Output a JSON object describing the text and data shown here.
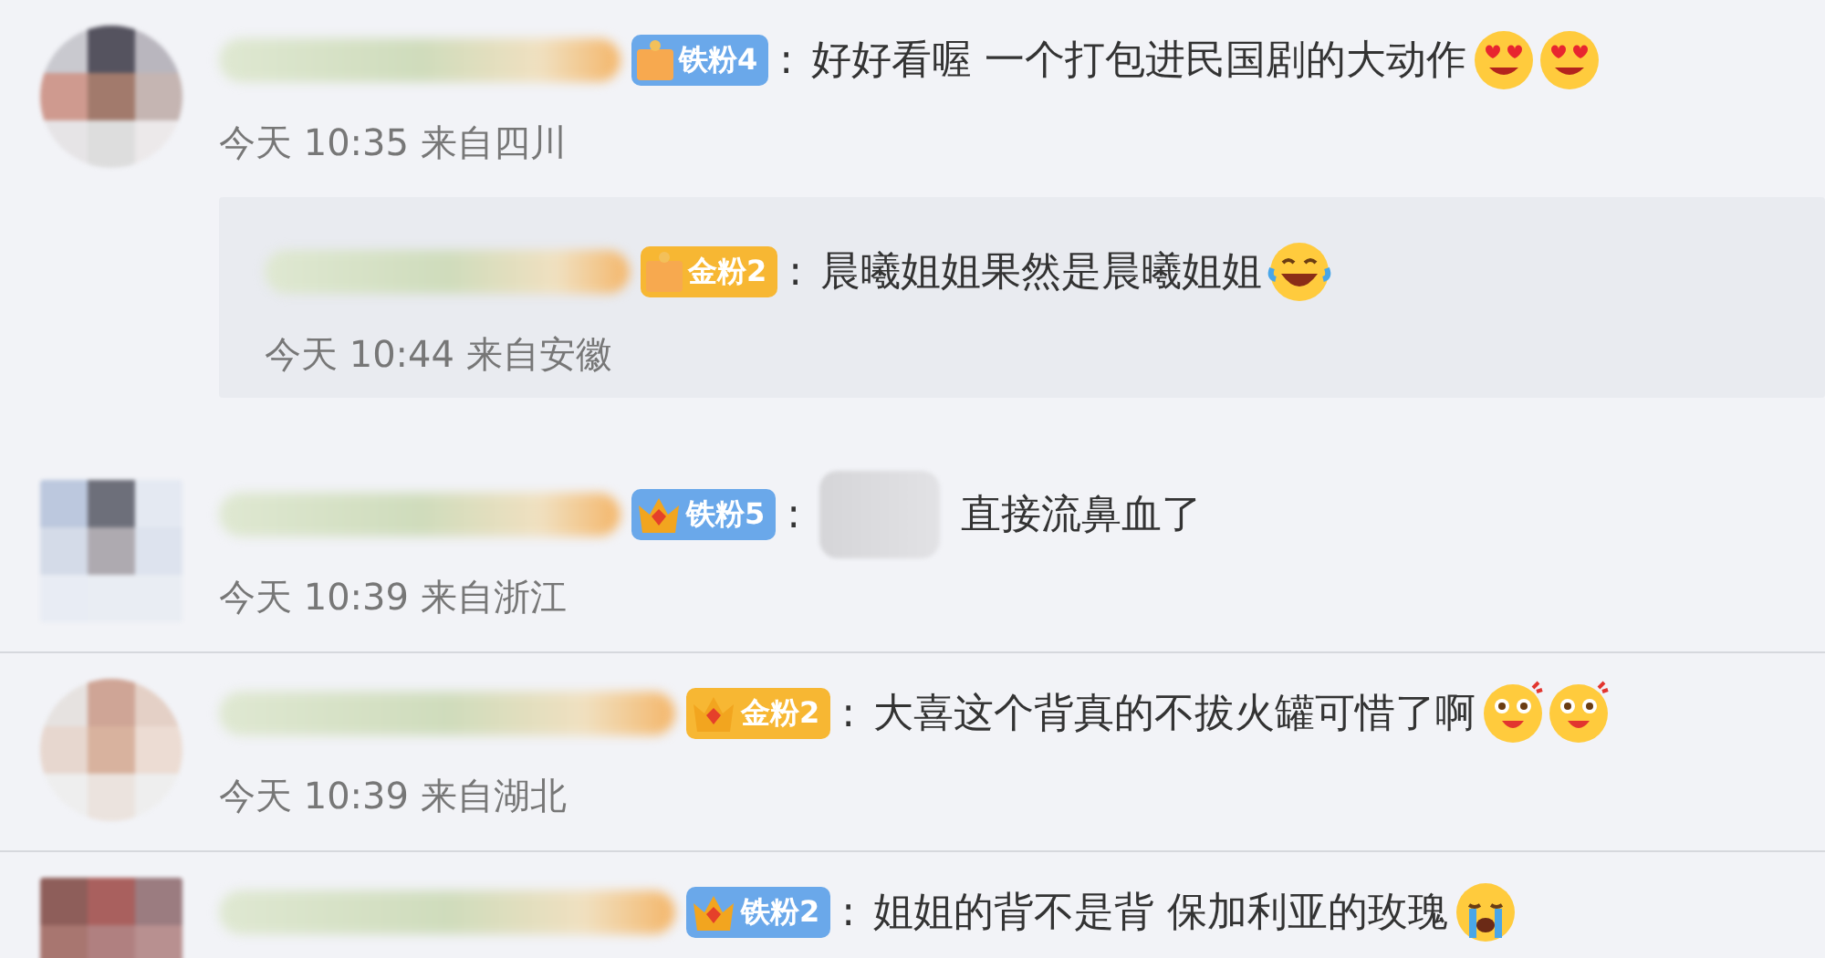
{
  "comments": [
    {
      "badge": {
        "kind": "iron",
        "label": "铁粉4"
      },
      "colon": ":",
      "text": "好好看喔 一个打包进民国剧的大动作",
      "time": "今天 10:35 来自四川",
      "replies": [
        {
          "badge": {
            "kind": "gold",
            "label": "金粉2"
          },
          "colon": ":",
          "text": "晨曦姐姐果然是晨曦姐姐",
          "time": "今天 10:44 来自安徽"
        }
      ]
    },
    {
      "badge": {
        "kind": "iron",
        "label": "铁粉5",
        "crown": true
      },
      "colon": ":",
      "image": true,
      "text": "直接流鼻血了",
      "time": "今天 10:39 来自浙江",
      "divider": true
    },
    {
      "badge": {
        "kind": "gold",
        "label": "金粉2",
        "crown": true
      },
      "colon": ":",
      "text": "大喜这个背真的不拔火罐可惜了啊",
      "time": "今天 10:39 来自湖北",
      "divider": true
    },
    {
      "badge": {
        "kind": "iron",
        "label": "铁粉2",
        "crown": true
      },
      "colon": ":",
      "text": "姐姐的背不是背 保加利亚的玫瑰"
    }
  ]
}
